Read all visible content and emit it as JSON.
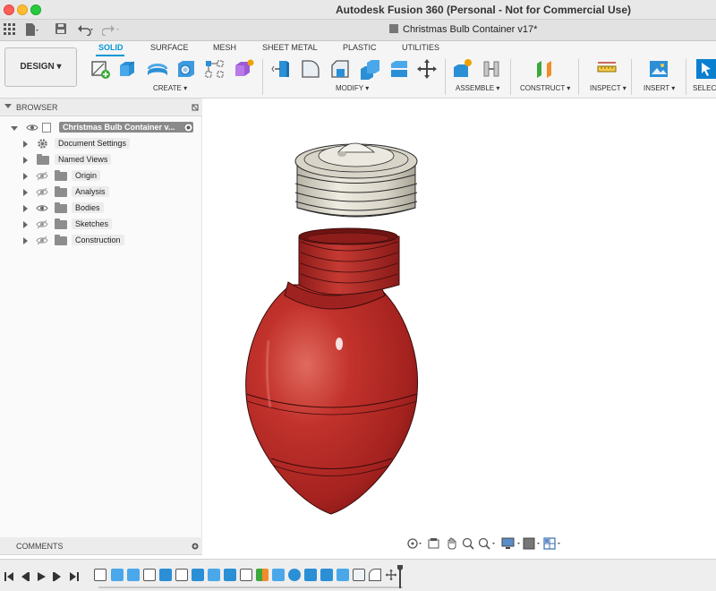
{
  "app": {
    "title": "Autodesk Fusion 360 (Personal - Not for Commercial Use)",
    "document_tab": "Christmas Bulb Container v17*"
  },
  "toolbar": {
    "workspace": "DESIGN ▾",
    "tabs": [
      "SOLID",
      "SURFACE",
      "MESH",
      "SHEET METAL",
      "PLASTIC",
      "UTILITIES"
    ],
    "active_tab": "SOLID",
    "groups": [
      "CREATE ▾",
      "MODIFY ▾",
      "ASSEMBLE ▾",
      "CONSTRUCT ▾",
      "INSPECT ▾",
      "INSERT ▾",
      "SELECT"
    ]
  },
  "browser": {
    "header": "BROWSER",
    "root": "Christmas Bulb Container v...",
    "items": [
      "Document Settings",
      "Named Views",
      "Origin",
      "Analysis",
      "Bodies",
      "Sketches",
      "Construction"
    ]
  },
  "comments": {
    "header": "COMMENTS"
  },
  "colors": {
    "accent": "#0696d7",
    "bulb_red": "#b72a26",
    "cap_beige": "#e4e1d6"
  }
}
